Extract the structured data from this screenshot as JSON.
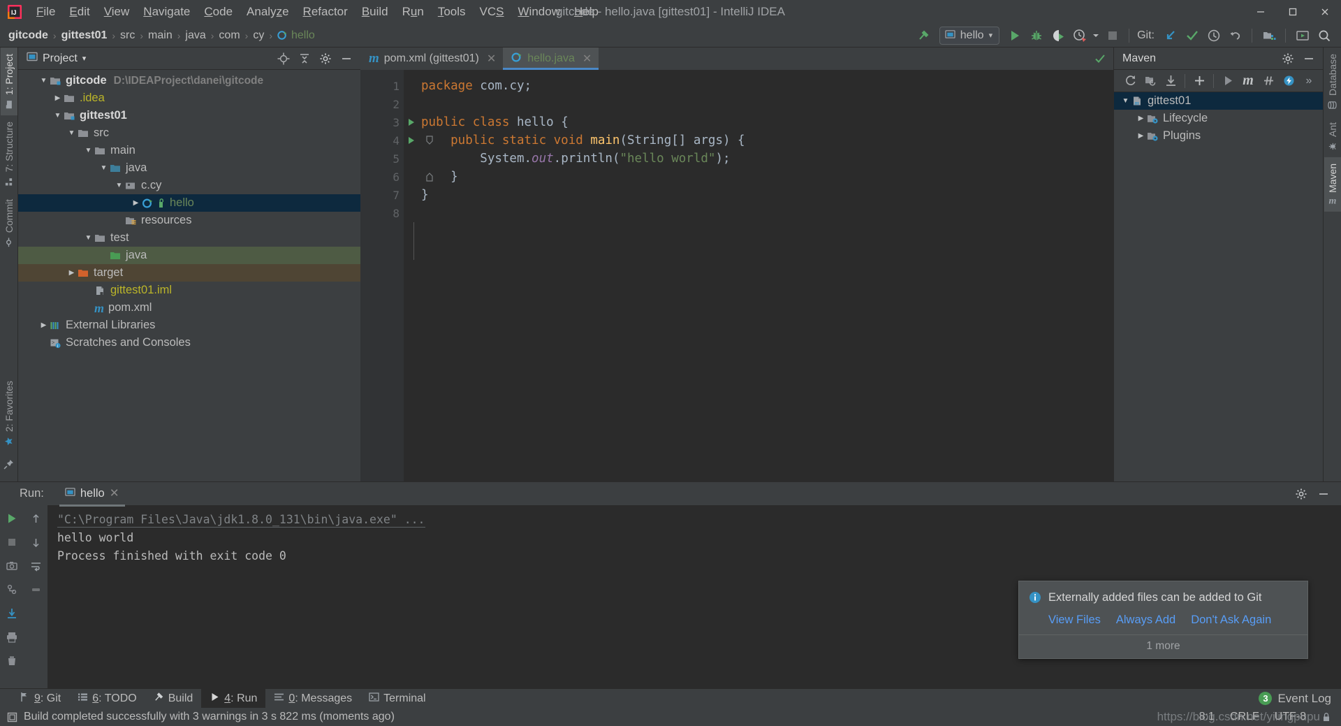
{
  "window": {
    "title": "gitcode - hello.java [gittest01] - IntelliJ IDEA",
    "minimize": "—",
    "maximize": "▢",
    "close": "✕"
  },
  "menu": {
    "items": [
      "File",
      "Edit",
      "View",
      "Navigate",
      "Code",
      "Analyze",
      "Refactor",
      "Build",
      "Run",
      "Tools",
      "VCS",
      "Window",
      "Help"
    ]
  },
  "breadcrumb": {
    "items": [
      {
        "label": "gitcode",
        "bold": true
      },
      {
        "label": "gittest01",
        "bold": true
      },
      {
        "label": "src",
        "bold": false
      },
      {
        "label": "main",
        "bold": false
      },
      {
        "label": "java",
        "bold": false
      },
      {
        "label": "com",
        "bold": false
      },
      {
        "label": "cy",
        "bold": false
      },
      {
        "label": "hello",
        "bold": false,
        "icon": "java-class-icon",
        "green": true
      }
    ],
    "separator": "›"
  },
  "toolbar": {
    "build_icon": "hammer-icon",
    "run_config": {
      "label": "hello",
      "icon": "run-config-icon",
      "chevron": "▾"
    },
    "run_icon": "run-icon",
    "debug_icon": "debug-icon",
    "run_coverage_icon": "run-with-coverage-icon",
    "profiler_icon": "profiler-icon",
    "profiler_chevron": "▾",
    "stop_icon": "stop-icon",
    "git_label": "Git:",
    "git_update_icon": "update-project-icon",
    "git_commit_icon": "commit-icon",
    "git_history_icon": "history-icon",
    "git_rollback_icon": "rollback-icon",
    "project_structure_icon": "project-structure-icon",
    "run_anything_icon": "run-anything-icon",
    "search_icon": "search-everywhere-icon"
  },
  "left_strip": {
    "tabs": [
      {
        "label": "1: Project",
        "icon": "project-icon",
        "active": true
      },
      {
        "label": "7: Structure",
        "icon": "structure-icon",
        "active": false
      },
      {
        "label": "Commit",
        "icon": "commit-icon",
        "active": false
      }
    ],
    "bottom_tabs": [
      {
        "label": "2: Favorites",
        "icon": "favorites-icon"
      }
    ]
  },
  "right_strip": {
    "tabs": [
      {
        "label": "Database",
        "icon": "database-icon"
      },
      {
        "label": "Ant",
        "icon": "ant-icon"
      },
      {
        "label": "Maven",
        "icon": "maven-icon",
        "active": true
      }
    ]
  },
  "project_panel": {
    "title": "Project",
    "chevron": "▾",
    "actions": [
      "locate-icon",
      "collapse-all-icon",
      "settings-icon",
      "hide-icon"
    ],
    "tree": [
      {
        "indent": 0,
        "arrow": "▼",
        "icon": "module-folder-icon",
        "label": "gitcode",
        "bold": true,
        "path": "D:\\IDEAProject\\danei\\gitcode"
      },
      {
        "indent": 1,
        "arrow": "▶",
        "icon": "folder-icon",
        "label": ".idea",
        "color": "yellow"
      },
      {
        "indent": 1,
        "arrow": "▼",
        "icon": "module-folder-icon",
        "label": "gittest01",
        "bold": true
      },
      {
        "indent": 2,
        "arrow": "▼",
        "icon": "folder-icon",
        "label": "src"
      },
      {
        "indent": 3,
        "arrow": "▼",
        "icon": "folder-icon",
        "label": "main"
      },
      {
        "indent": 4,
        "arrow": "▼",
        "icon": "source-root-icon",
        "label": "java"
      },
      {
        "indent": 5,
        "arrow": "▼",
        "icon": "package-icon",
        "label": "c.cy"
      },
      {
        "indent": 6,
        "arrow": "▶",
        "icon": "java-class-icon",
        "label": "hello",
        "selected": true,
        "color": "green",
        "badge": "run-badge-icon"
      },
      {
        "indent": 5,
        "arrow": "",
        "icon": "resource-root-icon",
        "label": "resources"
      },
      {
        "indent": 3,
        "arrow": "▼",
        "icon": "folder-icon",
        "label": "test"
      },
      {
        "indent": 4,
        "arrow": "",
        "icon": "test-source-root-icon",
        "label": "java",
        "highlight": "green"
      },
      {
        "indent": 2,
        "arrow": "▶",
        "icon": "excluded-folder-icon",
        "label": "target",
        "highlight": "brown"
      },
      {
        "indent": 3,
        "arrow": "",
        "icon": "iml-file-icon",
        "label": "gittest01.iml",
        "color": "yellow"
      },
      {
        "indent": 3,
        "arrow": "",
        "icon": "maven-file-icon",
        "label": "pom.xml"
      },
      {
        "indent": 0,
        "arrow": "▶",
        "icon": "external-libraries-icon",
        "label": "External Libraries"
      },
      {
        "indent": 0,
        "arrow": "",
        "icon": "scratches-icon",
        "label": "Scratches and Consoles"
      }
    ]
  },
  "editor": {
    "tabs": [
      {
        "label": "pom.xml (gittest01)",
        "icon": "maven-file-icon",
        "active": false,
        "close": "✕"
      },
      {
        "label": "hello.java",
        "icon": "java-class-icon",
        "active": true,
        "close": "✕"
      }
    ],
    "inspection_status": "✓",
    "lines": [
      {
        "num": "1",
        "run_marker": false,
        "fold_marker": false,
        "tokens": [
          {
            "t": "package ",
            "c": "kw"
          },
          {
            "t": "com.cy;",
            "c": "pln"
          }
        ]
      },
      {
        "num": "2",
        "run_marker": false,
        "fold_marker": false,
        "tokens": []
      },
      {
        "num": "3",
        "run_marker": true,
        "fold_marker": false,
        "tokens": [
          {
            "t": "public class ",
            "c": "kw"
          },
          {
            "t": "hello ",
            "c": "pln"
          },
          {
            "t": "{",
            "c": "pln"
          }
        ]
      },
      {
        "num": "4",
        "run_marker": true,
        "fold_marker": true,
        "tokens": [
          {
            "t": "    public static void ",
            "c": "kw"
          },
          {
            "t": "main",
            "c": "fn"
          },
          {
            "t": "(String[] args) {",
            "c": "pln"
          }
        ]
      },
      {
        "num": "5",
        "run_marker": false,
        "fold_marker": false,
        "tokens": [
          {
            "t": "        System.",
            "c": "pln"
          },
          {
            "t": "out",
            "c": "fld"
          },
          {
            "t": ".println(",
            "c": "pln"
          },
          {
            "t": "\"hello world\"",
            "c": "str"
          },
          {
            "t": ");",
            "c": "pln"
          }
        ]
      },
      {
        "num": "6",
        "run_marker": false,
        "fold_marker": false,
        "tokens": [
          {
            "t": "    }",
            "c": "pln"
          }
        ]
      },
      {
        "num": "7",
        "run_marker": false,
        "fold_marker": false,
        "tokens": [
          {
            "t": "}",
            "c": "pln"
          }
        ]
      },
      {
        "num": "8",
        "run_marker": false,
        "fold_marker": false,
        "tokens": []
      }
    ]
  },
  "maven_panel": {
    "title": "Maven",
    "actions": [
      "settings-icon",
      "hide-icon"
    ],
    "toolbar": [
      "reimport-icon",
      "generate-sources-icon",
      "download-sources-icon",
      "add-icon",
      "run-icon",
      "maven-goal-icon",
      "toggle-offline-icon",
      "toggle-skip-tests-icon",
      "more-icon"
    ],
    "more_label": "»",
    "tree": [
      {
        "indent": 0,
        "arrow": "▼",
        "icon": "maven-project-icon",
        "label": "gittest01",
        "selected": true
      },
      {
        "indent": 1,
        "arrow": "▶",
        "icon": "lifecycle-folder-icon",
        "label": "Lifecycle"
      },
      {
        "indent": 1,
        "arrow": "▶",
        "icon": "plugins-folder-icon",
        "label": "Plugins"
      }
    ]
  },
  "run_panel": {
    "label": "Run:",
    "tab": {
      "label": "hello",
      "icon": "run-config-icon",
      "close": "✕"
    },
    "head_actions": [
      "settings-icon",
      "hide-icon"
    ],
    "tools_left": [
      "rerun-icon",
      "stop-icon",
      "screenshot-icon",
      "dump-threads-icon",
      "export-icon",
      "print-icon",
      "trash-icon"
    ],
    "tools_right": [
      "scroll-up-icon",
      "scroll-down-icon",
      "soft-wrap-icon",
      "scroll-to-end-icon"
    ],
    "console": {
      "command": "\"C:\\Program Files\\Java\\jdk1.8.0_131\\bin\\java.exe\" ...",
      "lines": [
        "hello world",
        "",
        "Process finished with exit code 0"
      ]
    }
  },
  "notification": {
    "icon": "info-icon",
    "message": "Externally added files can be added to Git",
    "links": [
      "View Files",
      "Always Add",
      "Don't Ask Again"
    ],
    "more": "1 more"
  },
  "bottom_bar": {
    "tabs": [
      {
        "label": "9: Git",
        "underline": "9",
        "icon": "git-icon",
        "active": false
      },
      {
        "label": "6: TODO",
        "underline": "6",
        "icon": "todo-icon",
        "active": false
      },
      {
        "label": "Build",
        "underline": "",
        "icon": "build-icon",
        "active": false
      },
      {
        "label": "4: Run",
        "underline": "4",
        "icon": "run-icon",
        "active": true
      },
      {
        "label": "0: Messages",
        "underline": "0",
        "icon": "messages-icon",
        "active": false
      },
      {
        "label": "Terminal",
        "underline": "",
        "icon": "terminal-icon",
        "active": false
      }
    ],
    "event_log": {
      "label": "Event Log",
      "count": "3"
    }
  },
  "status_bar": {
    "icon": "build-status-icon",
    "message": "Build completed successfully with 3 warnings in 3 s 822 ms (moments ago)",
    "caret": "8:1",
    "line_separator": "CRLF",
    "encoding": "UTF-8",
    "watermark": "https://blog.csdn.net/yilingpupu"
  },
  "colors": {
    "accent_blue": "#4a88c7",
    "selection_blue": "#0d293e",
    "green_text": "#6a8759",
    "keyword_orange": "#cc7832",
    "method_yellow": "#ffc66d",
    "field_purple": "#9876aa",
    "panel_bg": "#3c3f41",
    "editor_bg": "#2b2b2b",
    "link_blue": "#589df6"
  }
}
